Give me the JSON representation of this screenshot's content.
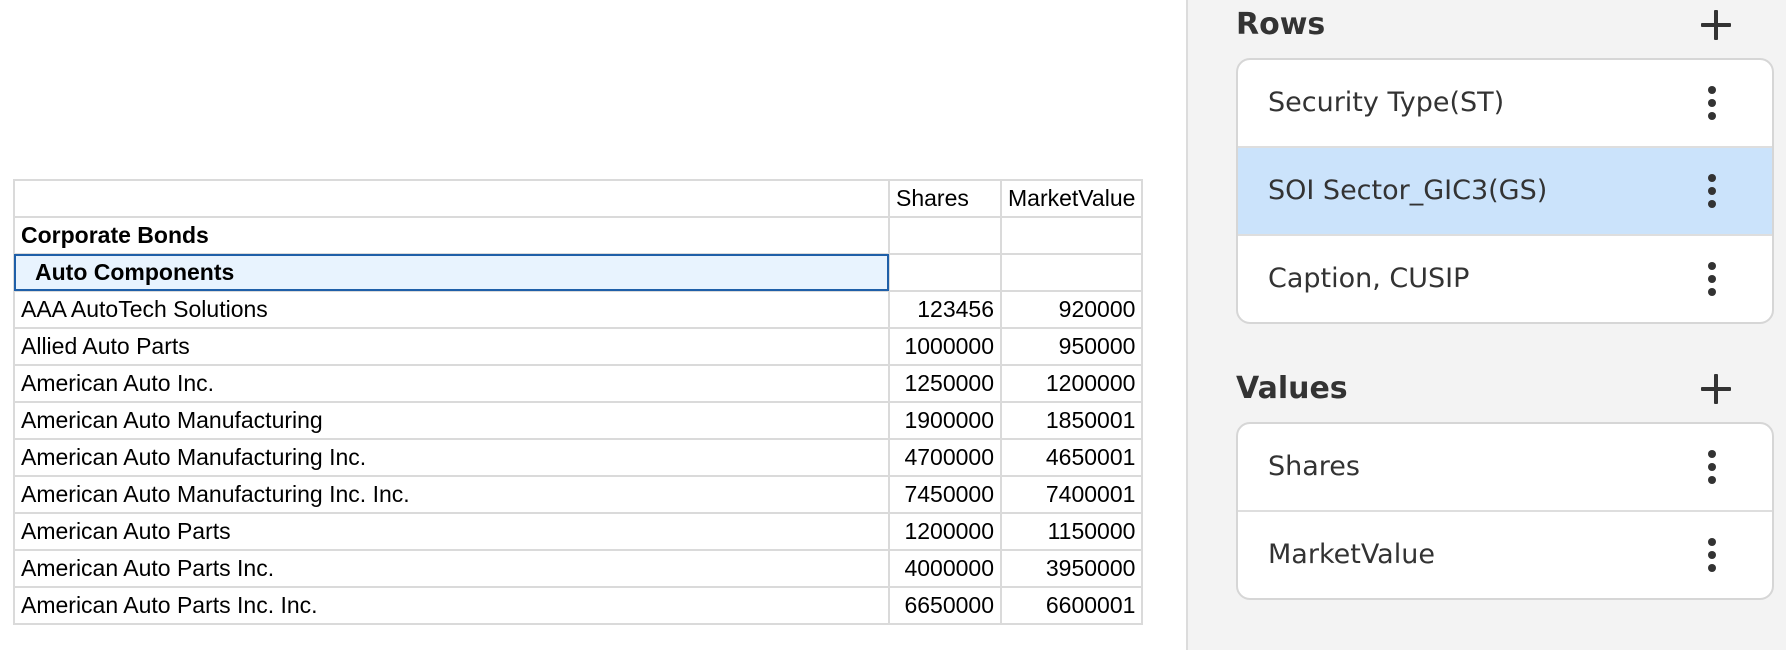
{
  "table": {
    "columns": [
      "",
      "Shares",
      "MarketValue"
    ],
    "group_label": "Corporate Bonds",
    "subgroup_label": "Auto Components",
    "rows": [
      {
        "name": "AAA AutoTech Solutions",
        "shares": "123456",
        "market_value": "920000"
      },
      {
        "name": "Allied Auto Parts",
        "shares": "1000000",
        "market_value": "950000"
      },
      {
        "name": "American Auto Inc.",
        "shares": "1250000",
        "market_value": "1200000"
      },
      {
        "name": "American Auto Manufacturing",
        "shares": "1900000",
        "market_value": "1850001"
      },
      {
        "name": "American Auto Manufacturing Inc.",
        "shares": "4700000",
        "market_value": "4650001"
      },
      {
        "name": "American Auto Manufacturing Inc. Inc.",
        "shares": "7450000",
        "market_value": "7400001"
      },
      {
        "name": "American Auto Parts",
        "shares": "1200000",
        "market_value": "1150000"
      },
      {
        "name": "American Auto Parts Inc.",
        "shares": "4000000",
        "market_value": "3950000"
      },
      {
        "name": "American Auto Parts Inc. Inc.",
        "shares": "6650000",
        "market_value": "6600001"
      }
    ]
  },
  "panel": {
    "rows_section": {
      "title": "Rows",
      "items": [
        "Security Type(ST)",
        "SOI Sector_GIC3(GS)",
        "Caption, CUSIP"
      ],
      "selected_item": "SOI Sector_GIC3(GS)"
    },
    "values_section": {
      "title": "Values",
      "items": [
        "Shares",
        "MarketValue"
      ]
    }
  },
  "colors": {
    "selected_field_bg": "#cbe3fb",
    "selected_cell_bg": "#e8f3fe",
    "selected_cell_border": "#1f5fa8",
    "panel_bg": "#f3f3f3"
  }
}
